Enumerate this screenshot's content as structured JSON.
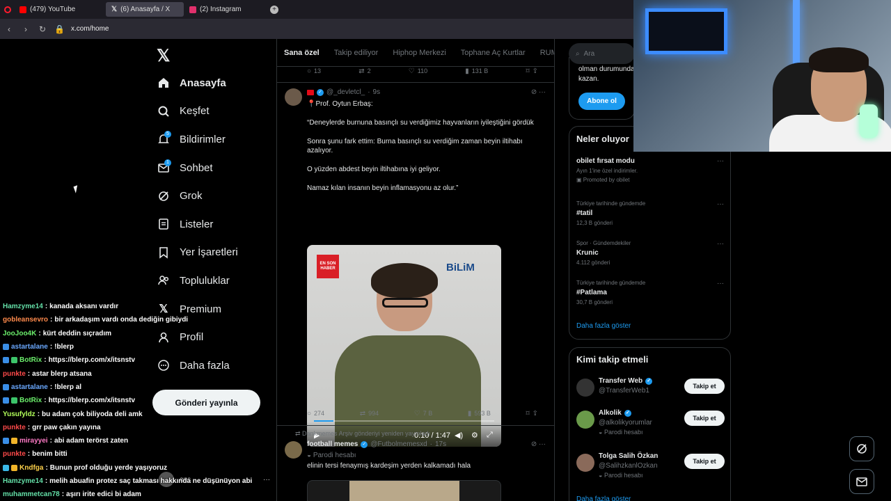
{
  "browser": {
    "tabs": [
      {
        "label": "(479) YouTube",
        "color": "#ff0000"
      },
      {
        "label": "(6) Anasayfa / X",
        "color": "#ffffff"
      },
      {
        "label": "(2) Instagram",
        "color": "#e1306c"
      }
    ],
    "url": "x.com/home"
  },
  "nav": {
    "items": [
      {
        "label": "Anasayfa",
        "icon": "home-icon"
      },
      {
        "label": "Keşfet",
        "icon": "search-icon"
      },
      {
        "label": "Bildirimler",
        "icon": "bell-icon",
        "badge": "5"
      },
      {
        "label": "Sohbet",
        "icon": "mail-icon",
        "badge": "1"
      },
      {
        "label": "Grok",
        "icon": "grok-icon"
      },
      {
        "label": "Listeler",
        "icon": "list-icon"
      },
      {
        "label": "Yer İşaretleri",
        "icon": "bookmark-icon"
      },
      {
        "label": "Topluluklar",
        "icon": "people-icon"
      },
      {
        "label": "Premium",
        "icon": "x-icon"
      },
      {
        "label": "Profil",
        "icon": "person-icon"
      },
      {
        "label": "Daha fazla",
        "icon": "more-icon"
      }
    ],
    "post_button": "Gönderi yayınla",
    "account_name": "ens",
    "account_more": "···"
  },
  "chat": [
    {
      "user": "Hamzyme14",
      "color": "#64e0a8",
      "msg": "kanada aksanı vardır",
      "badges": []
    },
    {
      "user": "gobleansevro",
      "color": "#ff8a4c",
      "msg": "bir arkadaşım vardı onda dediğin gibiydi",
      "badges": []
    },
    {
      "user": "JooJoo4K",
      "color": "#6cf06c",
      "msg": "kürt deddin sıçradım",
      "badges": []
    },
    {
      "user": "astartalane",
      "color": "#6aa8ff",
      "msg": "!blerp",
      "badges": [
        "#3a8ee6"
      ]
    },
    {
      "user": "BotRix",
      "color": "#6cf06c",
      "msg": "https://blerp.com/x/itsnstv",
      "badges": [
        "#3a8ee6",
        "#3cc46a"
      ]
    },
    {
      "user": "punkte",
      "color": "#ff4a4a",
      "msg": "astar blerp atsana",
      "badges": []
    },
    {
      "user": "astartalane",
      "color": "#6aa8ff",
      "msg": "!blerp al",
      "badges": [
        "#3a8ee6"
      ]
    },
    {
      "user": "BotRix",
      "color": "#6cf06c",
      "msg": "https://blerp.com/x/itsnstv",
      "badges": [
        "#3a8ee6",
        "#3cc46a"
      ]
    },
    {
      "user": "Yusufyldz",
      "color": "#b2ff5a",
      "msg": "bu adam çok biliyoda deli amk",
      "badges": []
    },
    {
      "user": "punkte",
      "color": "#ff4a4a",
      "msg": "grr paw çakın yayına",
      "badges": []
    },
    {
      "user": "mirayyei",
      "color": "#ff7ac6",
      "msg": "abi adam terörst zaten",
      "badges": [
        "#3a8ee6",
        "#f0b429"
      ]
    },
    {
      "user": "punkte",
      "color": "#ff4a4a",
      "msg": "benim bitti",
      "badges": []
    },
    {
      "user": "Kndfga",
      "color": "#ffd24a",
      "msg": "Bunun prof olduğu yerde yaşıyoruz",
      "badges": [
        "#3ab8e6",
        "#f0b429"
      ]
    },
    {
      "user": "Hamzyme14",
      "color": "#64e0a8",
      "msg": "melih abuafin protez saç takması hakkında ne düşünüyon abi",
      "badges": []
    },
    {
      "user": "muhammetcan78",
      "color": "#64e0a8",
      "msg": "aşırı irite edici bi adam",
      "badges": []
    }
  ],
  "feed": {
    "tabs": [
      "Sana özel",
      "Takip ediliyor",
      "Hiphop Merkezi",
      "Tophane Aç Kurtlar",
      "RUMIL"
    ],
    "prev_actions": {
      "reply": "13",
      "repost": "2",
      "like": "110",
      "views": "131 B"
    },
    "post": {
      "handle": "@_devletcl_",
      "time": "9s",
      "name_line": "📍Prof. Oytun Erbaş:",
      "paragraphs": [
        "“Deneylerde burnuna basınçlı su verdiğimiz hayvanların iyileştiğini gördük",
        "Sonra şunu fark ettim: Burna basınçlı su verdiğim zaman beyin iltihabı azalıyor.",
        "O yüzden abdest beyin iltihabına iyi geliyor.",
        "Namaz kılan insanın beyin inflamasyonu az olur.”"
      ],
      "video": {
        "logo": "EN SON HABER",
        "brand": "BiLiM",
        "time": "0:10 / 1:47",
        "progress": 0.11
      },
      "actions": {
        "reply": "274",
        "repost": "994",
        "like": "7 B",
        "views": "593 B"
      }
    },
    "post2": {
      "repost_note": "Dankmemes Arşiv gönderiyi yeniden yayınladı",
      "name": "football memes",
      "handle": "@Futbolmemesxd",
      "time": "17s",
      "label": "Parodi hesabı",
      "text": "elinin tersi fenaymış kardeşim yerden kalkamadı hala"
    }
  },
  "right": {
    "search_placeholder": "Ara",
    "premium_text": "olman durumunda kazan.",
    "subscribe": "Abone ol",
    "trends_title": "Neler oluyor",
    "trends": [
      {
        "ctx": "",
        "name": "obilet fırsat modu",
        "sub": "Ayın 1'ine özel indirimler.",
        "promo": "Promoted by obilet"
      },
      {
        "ctx": "Türkiye tarihinde gündemde",
        "name": "#tatil",
        "sub": "12,3 B gönderi"
      },
      {
        "ctx": "Spor · Gündemdekiler",
        "name": "Krunic",
        "sub": "4.112 gönderi"
      },
      {
        "ctx": "Türkiye tarihinde gündemde",
        "name": "#Patlama",
        "sub": "30,7 B gönderi"
      }
    ],
    "show_more": "Daha fazla göster",
    "who_title": "Kimi takip etmeli",
    "who": [
      {
        "name": "Transfer Web",
        "handle": "@TransferWeb1",
        "parody": "",
        "color": "#333333"
      },
      {
        "name": "Alkolik",
        "handle": "@alkolikyorumlar",
        "parody": "Parodi hesabı",
        "color": "#6a9a4a"
      },
      {
        "name": "Tolga Salih Özkan",
        "handle": "@SalihzkanlOzkan",
        "parody": "Parodi hesabı",
        "color": "#8a6a5a"
      }
    ],
    "follow_label": "Takip et",
    "show_more2": "Daha fazla göster"
  }
}
